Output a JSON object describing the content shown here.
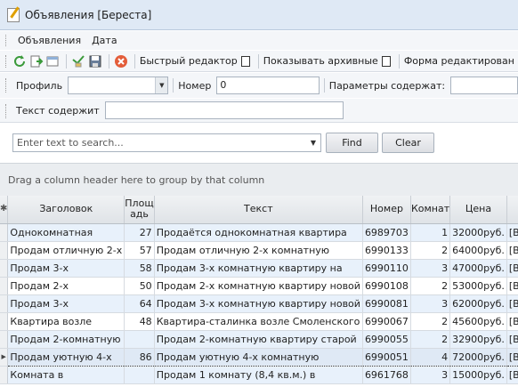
{
  "window": {
    "title": "Объявления [Береста]"
  },
  "menu": {
    "items": [
      "Объявления",
      "Дата"
    ]
  },
  "toolbar": {
    "quick_editor_label": "Быстрый редактор",
    "show_archive_label": "Показывать архивные",
    "edit_form_label": "Форма редактирован"
  },
  "filters": {
    "profile_label": "Профиль",
    "profile_value": "",
    "number_label": "Номер",
    "number_value": "0",
    "params_label": "Параметры содержат:",
    "params_value": "",
    "text_label": "Текст содержит",
    "text_value": ""
  },
  "search": {
    "placeholder": "Enter text to search...",
    "find_label": "Find",
    "clear_label": "Clear"
  },
  "group_panel": {
    "hint": "Drag a column header here to group by that column"
  },
  "grid": {
    "indicator_header": "✱",
    "columns": [
      "Заголовок",
      "Площ\nадь",
      "Текст",
      "Номер",
      "Комнат",
      "Цена",
      ""
    ],
    "rows": [
      {
        "title": "Однокомнатная",
        "area": "27",
        "text": "Продаётся однокомнатная квартира",
        "number": "6989703",
        "rooms": "1",
        "price": "32000руб.",
        "extra": "[ВитеС"
      },
      {
        "title": "Продам отличную 2-х",
        "area": "57",
        "text": "Продам отличную 2-х комнатную",
        "number": "6990133",
        "rooms": "2",
        "price": "64000руб.",
        "extra": "[ВитеС"
      },
      {
        "title": "Продам 3-х",
        "area": "58",
        "text": "Продам 3-х комнатную квартиру на",
        "number": "6990110",
        "rooms": "3",
        "price": "47000руб.",
        "extra": "[ВитеС"
      },
      {
        "title": "Продам 2-х",
        "area": "50",
        "text": "Продам 2-х комнатную квартиру новой",
        "number": "6990108",
        "rooms": "2",
        "price": "53000руб.",
        "extra": "[ВитеС"
      },
      {
        "title": "Продам 3-х",
        "area": "64",
        "text": "Продам 3-х комнатную квартиру новой",
        "number": "6990081",
        "rooms": "3",
        "price": "62000руб.",
        "extra": "[ВитеС"
      },
      {
        "title": "Квартира возле",
        "area": "48",
        "text": "Квартира-сталинка возле Смоленского",
        "number": "6990067",
        "rooms": "2",
        "price": "45600руб.",
        "extra": "[ВитеС"
      },
      {
        "title": "Продам 2-комнатную",
        "area": "",
        "text": "Продам 2-комнатную квартиру старой",
        "number": "6990055",
        "rooms": "2",
        "price": "32900руб.",
        "extra": "[ВитеС"
      },
      {
        "title": "Продам уютную 4-х",
        "area": "86",
        "text": "Продам уютную 4-х комнатную",
        "number": "6990051",
        "rooms": "4",
        "price": "72000руб.",
        "extra": "[ВитеС"
      },
      {
        "title": "Комната в",
        "area": "",
        "text": "Продам 1 комнату (8,4 кв.м.) в",
        "number": "6961768",
        "rooms": "3",
        "price": "15000руб.",
        "extra": "[ВитеС"
      }
    ],
    "focused_row": 7
  },
  "colors": {
    "title_bar": "#dfe9f5",
    "row_alt": "#e8f1fb",
    "delete_icon": "#e35d3a"
  }
}
